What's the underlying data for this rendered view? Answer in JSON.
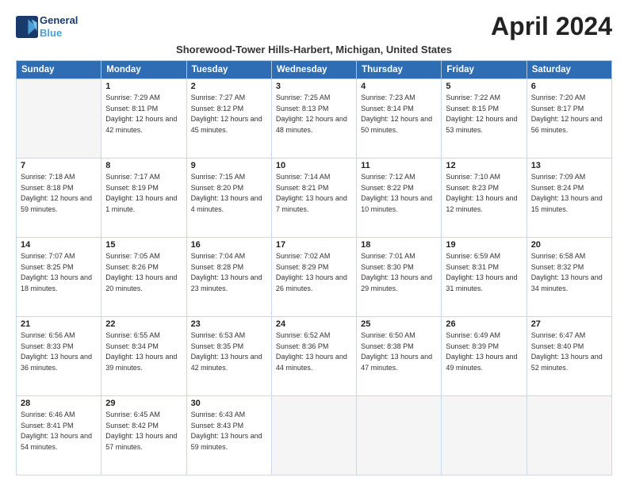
{
  "header": {
    "logo_line1": "General",
    "logo_line2": "Blue",
    "month_title": "April 2024",
    "subtitle": "Shorewood-Tower Hills-Harbert, Michigan, United States"
  },
  "weekdays": [
    "Sunday",
    "Monday",
    "Tuesday",
    "Wednesday",
    "Thursday",
    "Friday",
    "Saturday"
  ],
  "weeks": [
    [
      {
        "day": "",
        "sunrise": "",
        "sunset": "",
        "daylight": ""
      },
      {
        "day": "1",
        "sunrise": "Sunrise: 7:29 AM",
        "sunset": "Sunset: 8:11 PM",
        "daylight": "Daylight: 12 hours and 42 minutes."
      },
      {
        "day": "2",
        "sunrise": "Sunrise: 7:27 AM",
        "sunset": "Sunset: 8:12 PM",
        "daylight": "Daylight: 12 hours and 45 minutes."
      },
      {
        "day": "3",
        "sunrise": "Sunrise: 7:25 AM",
        "sunset": "Sunset: 8:13 PM",
        "daylight": "Daylight: 12 hours and 48 minutes."
      },
      {
        "day": "4",
        "sunrise": "Sunrise: 7:23 AM",
        "sunset": "Sunset: 8:14 PM",
        "daylight": "Daylight: 12 hours and 50 minutes."
      },
      {
        "day": "5",
        "sunrise": "Sunrise: 7:22 AM",
        "sunset": "Sunset: 8:15 PM",
        "daylight": "Daylight: 12 hours and 53 minutes."
      },
      {
        "day": "6",
        "sunrise": "Sunrise: 7:20 AM",
        "sunset": "Sunset: 8:17 PM",
        "daylight": "Daylight: 12 hours and 56 minutes."
      }
    ],
    [
      {
        "day": "7",
        "sunrise": "Sunrise: 7:18 AM",
        "sunset": "Sunset: 8:18 PM",
        "daylight": "Daylight: 12 hours and 59 minutes."
      },
      {
        "day": "8",
        "sunrise": "Sunrise: 7:17 AM",
        "sunset": "Sunset: 8:19 PM",
        "daylight": "Daylight: 13 hours and 1 minute."
      },
      {
        "day": "9",
        "sunrise": "Sunrise: 7:15 AM",
        "sunset": "Sunset: 8:20 PM",
        "daylight": "Daylight: 13 hours and 4 minutes."
      },
      {
        "day": "10",
        "sunrise": "Sunrise: 7:14 AM",
        "sunset": "Sunset: 8:21 PM",
        "daylight": "Daylight: 13 hours and 7 minutes."
      },
      {
        "day": "11",
        "sunrise": "Sunrise: 7:12 AM",
        "sunset": "Sunset: 8:22 PM",
        "daylight": "Daylight: 13 hours and 10 minutes."
      },
      {
        "day": "12",
        "sunrise": "Sunrise: 7:10 AM",
        "sunset": "Sunset: 8:23 PM",
        "daylight": "Daylight: 13 hours and 12 minutes."
      },
      {
        "day": "13",
        "sunrise": "Sunrise: 7:09 AM",
        "sunset": "Sunset: 8:24 PM",
        "daylight": "Daylight: 13 hours and 15 minutes."
      }
    ],
    [
      {
        "day": "14",
        "sunrise": "Sunrise: 7:07 AM",
        "sunset": "Sunset: 8:25 PM",
        "daylight": "Daylight: 13 hours and 18 minutes."
      },
      {
        "day": "15",
        "sunrise": "Sunrise: 7:05 AM",
        "sunset": "Sunset: 8:26 PM",
        "daylight": "Daylight: 13 hours and 20 minutes."
      },
      {
        "day": "16",
        "sunrise": "Sunrise: 7:04 AM",
        "sunset": "Sunset: 8:28 PM",
        "daylight": "Daylight: 13 hours and 23 minutes."
      },
      {
        "day": "17",
        "sunrise": "Sunrise: 7:02 AM",
        "sunset": "Sunset: 8:29 PM",
        "daylight": "Daylight: 13 hours and 26 minutes."
      },
      {
        "day": "18",
        "sunrise": "Sunrise: 7:01 AM",
        "sunset": "Sunset: 8:30 PM",
        "daylight": "Daylight: 13 hours and 29 minutes."
      },
      {
        "day": "19",
        "sunrise": "Sunrise: 6:59 AM",
        "sunset": "Sunset: 8:31 PM",
        "daylight": "Daylight: 13 hours and 31 minutes."
      },
      {
        "day": "20",
        "sunrise": "Sunrise: 6:58 AM",
        "sunset": "Sunset: 8:32 PM",
        "daylight": "Daylight: 13 hours and 34 minutes."
      }
    ],
    [
      {
        "day": "21",
        "sunrise": "Sunrise: 6:56 AM",
        "sunset": "Sunset: 8:33 PM",
        "daylight": "Daylight: 13 hours and 36 minutes."
      },
      {
        "day": "22",
        "sunrise": "Sunrise: 6:55 AM",
        "sunset": "Sunset: 8:34 PM",
        "daylight": "Daylight: 13 hours and 39 minutes."
      },
      {
        "day": "23",
        "sunrise": "Sunrise: 6:53 AM",
        "sunset": "Sunset: 8:35 PM",
        "daylight": "Daylight: 13 hours and 42 minutes."
      },
      {
        "day": "24",
        "sunrise": "Sunrise: 6:52 AM",
        "sunset": "Sunset: 8:36 PM",
        "daylight": "Daylight: 13 hours and 44 minutes."
      },
      {
        "day": "25",
        "sunrise": "Sunrise: 6:50 AM",
        "sunset": "Sunset: 8:38 PM",
        "daylight": "Daylight: 13 hours and 47 minutes."
      },
      {
        "day": "26",
        "sunrise": "Sunrise: 6:49 AM",
        "sunset": "Sunset: 8:39 PM",
        "daylight": "Daylight: 13 hours and 49 minutes."
      },
      {
        "day": "27",
        "sunrise": "Sunrise: 6:47 AM",
        "sunset": "Sunset: 8:40 PM",
        "daylight": "Daylight: 13 hours and 52 minutes."
      }
    ],
    [
      {
        "day": "28",
        "sunrise": "Sunrise: 6:46 AM",
        "sunset": "Sunset: 8:41 PM",
        "daylight": "Daylight: 13 hours and 54 minutes."
      },
      {
        "day": "29",
        "sunrise": "Sunrise: 6:45 AM",
        "sunset": "Sunset: 8:42 PM",
        "daylight": "Daylight: 13 hours and 57 minutes."
      },
      {
        "day": "30",
        "sunrise": "Sunrise: 6:43 AM",
        "sunset": "Sunset: 8:43 PM",
        "daylight": "Daylight: 13 hours and 59 minutes."
      },
      {
        "day": "",
        "sunrise": "",
        "sunset": "",
        "daylight": ""
      },
      {
        "day": "",
        "sunrise": "",
        "sunset": "",
        "daylight": ""
      },
      {
        "day": "",
        "sunrise": "",
        "sunset": "",
        "daylight": ""
      },
      {
        "day": "",
        "sunrise": "",
        "sunset": "",
        "daylight": ""
      }
    ]
  ]
}
